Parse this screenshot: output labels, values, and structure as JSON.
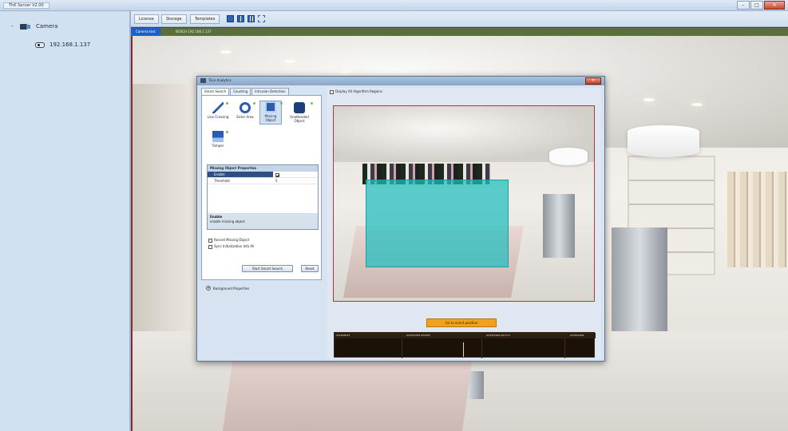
{
  "window": {
    "app_title": "ThK Server V2.00",
    "minimize": "–",
    "maximize": "□",
    "close": "✕"
  },
  "tree": {
    "root_label": "Camera",
    "expander": "-",
    "camera_ip": "192.168.1.137"
  },
  "toolbar": {
    "tabs": [
      "License",
      "Storage",
      "Templates"
    ]
  },
  "viewer": {
    "channel_label": "Camera test",
    "channel_info": "BOSCH 192.168.1.137"
  },
  "dialog": {
    "title": "Tilco Analytics",
    "close": "✕",
    "tabs": [
      "Smart Search",
      "Counting",
      "Intrusion Detection"
    ],
    "functions": [
      {
        "label": "Line Crossing",
        "icon": "line-crossing-icon"
      },
      {
        "label": "Enter Area",
        "icon": "enter-area-icon"
      },
      {
        "label": "Missing Object",
        "icon": "missing-object-icon"
      },
      {
        "label": "Unattended Object",
        "icon": "unattended-object-icon"
      },
      {
        "label": "Tamper",
        "icon": "tamper-icon"
      }
    ],
    "properties": {
      "header": "Missing Object Properties",
      "rows": [
        {
          "key": "Enable",
          "value": ""
        },
        {
          "key": "Threshold",
          "value": "5"
        }
      ],
      "desc_title": "Enable",
      "desc_text": "enable missing object"
    },
    "options": {
      "record": "Record Missing Object",
      "sync": "Sync Initialization Info All"
    },
    "buttons": {
      "start": "Start Smart Search",
      "reset": "Reset"
    },
    "background_properties": "Background Properties",
    "display_all": "Display All Algorithm Regions",
    "jump_button": "Go to event position",
    "timeline_labels": [
      "2018/08/23",
      "02/05/2009 00/08/0",
      "02/05/2009 00/17:0",
      "02/05/2009"
    ]
  },
  "colors": {
    "roi": "#1fbebe",
    "jump_button": "#f0a21e",
    "selection": "#2d4f86"
  }
}
